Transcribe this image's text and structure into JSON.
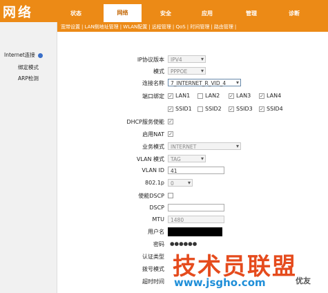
{
  "brand": "网络",
  "tabs": [
    "状态",
    "网络",
    "安全",
    "应用",
    "管理",
    "诊断"
  ],
  "subtabs": [
    "宽带设置",
    "LAN侧地址管理",
    "WLAN配置",
    "远程管理",
    "QoS",
    "时间管理",
    "路由管理"
  ],
  "sidebar": {
    "items": [
      "Internet连接",
      "绑定模式",
      "ARP检测"
    ]
  },
  "form": {
    "ip_version": {
      "label": "IP协议版本",
      "value": "IPV4"
    },
    "mode": {
      "label": "模式",
      "value": "PPPOE"
    },
    "connection": {
      "label": "连接名称",
      "value": "7_INTERNET_R_VID_4"
    },
    "port_binding": {
      "label": "端口绑定",
      "row1": [
        {
          "name": "LAN1",
          "checked": true
        },
        {
          "name": "LAN2",
          "checked": false
        },
        {
          "name": "LAN3",
          "checked": true
        },
        {
          "name": "LAN4",
          "checked": true
        }
      ],
      "row2": [
        {
          "name": "SSID1",
          "checked": true
        },
        {
          "name": "SSID2",
          "checked": false
        },
        {
          "name": "SSID3",
          "checked": true
        },
        {
          "name": "SSID4",
          "checked": true
        }
      ]
    },
    "dhcp": {
      "label": "DHCP服务使能",
      "checked": true
    },
    "nat": {
      "label": "启用NAT",
      "checked": true
    },
    "service_mode": {
      "label": "业务模式",
      "value": "INTERNET"
    },
    "vlan_mode": {
      "label": "VLAN 模式",
      "value": "TAG"
    },
    "vlan_id": {
      "label": "VLAN ID",
      "value": "41"
    },
    "p8021": {
      "label": "802.1p",
      "value": "0"
    },
    "use_dscp": {
      "label": "使能DSCP",
      "checked": false
    },
    "dscp": {
      "label": "DSCP",
      "value": ""
    },
    "mtu": {
      "label": "MTU",
      "value": "1480"
    },
    "username": {
      "label": "用户名"
    },
    "password": {
      "label": "密码",
      "value": "●●●●●●"
    },
    "auth_type": {
      "label": "认证类型"
    },
    "dial_mode": {
      "label": "拨号模式"
    },
    "timeout": {
      "label": "超时时间"
    }
  },
  "watermark": {
    "line1": "技术员联盟",
    "line2": "www.jsgho.com",
    "line3": "优友"
  }
}
